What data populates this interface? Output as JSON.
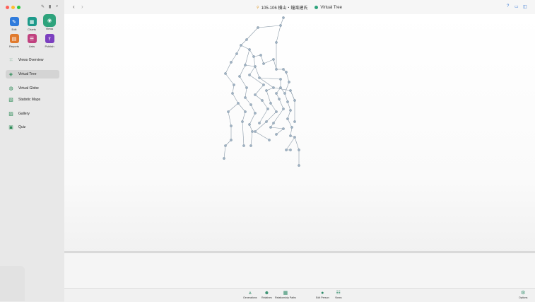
{
  "window": {
    "title_place": "105-106 横山・鐘楽建氏",
    "title_view": "Virtual Tree"
  },
  "toolbar": {
    "tools": [
      {
        "label": "Edit",
        "color": "#2f7bdc",
        "icon": "pencil-icon"
      },
      {
        "label": "Charts",
        "color": "#1d9a8a",
        "icon": "grid-icon"
      },
      {
        "label": "Views",
        "color": "#2ea37c",
        "icon": "eye-icon",
        "selected": true
      },
      {
        "label": "Reports",
        "color": "#e07a2e",
        "icon": "report-icon"
      },
      {
        "label": "Lists",
        "color": "#c0417f",
        "icon": "list-icon"
      },
      {
        "label": "Publish",
        "color": "#7b3fbf",
        "icon": "upload-icon"
      }
    ]
  },
  "sidebar": {
    "items": [
      {
        "label": "Views Overview",
        "icon": "grid-dots-icon"
      },
      {
        "label": "Virtual Tree",
        "icon": "cube-icon",
        "selected": true
      },
      {
        "label": "Virtual Globe",
        "icon": "globe-icon"
      },
      {
        "label": "Statistic Maps",
        "icon": "map-icon"
      },
      {
        "label": "Gallery",
        "icon": "picture-icon"
      },
      {
        "label": "Quiz",
        "icon": "quiz-icon"
      }
    ]
  },
  "bottombar": {
    "items": [
      {
        "label": "Generations",
        "icon": "generations-icon"
      },
      {
        "label": "Relatives",
        "icon": "relatives-icon"
      },
      {
        "label": "Relationship Paths",
        "icon": "paths-icon"
      },
      {
        "label": "Edit Person",
        "icon": "person-icon"
      },
      {
        "label": "Views",
        "icon": "views-icon"
      },
      {
        "label": "Options",
        "icon": "gear-icon"
      }
    ]
  },
  "colors": {
    "accent": "#2ea37c",
    "tree_line": "#8a9aa8",
    "tree_node": "#9fb2c4"
  }
}
